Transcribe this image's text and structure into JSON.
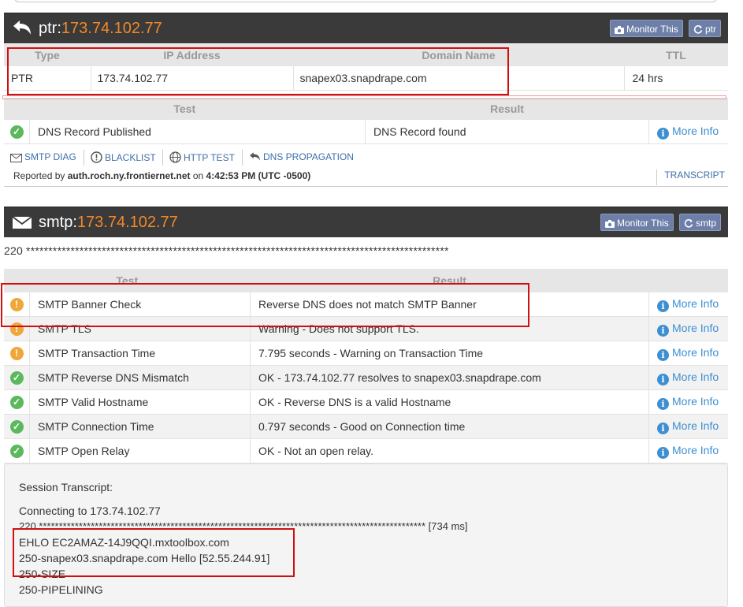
{
  "ptr": {
    "label": "ptr:",
    "ip": "173.74.102.77",
    "monitor_label": "Monitor This",
    "refresh_label": "ptr",
    "headers": [
      "Type",
      "IP Address",
      "Domain Name",
      "TTL"
    ],
    "row": {
      "type": "PTR",
      "ip": "173.74.102.77",
      "domain": "snapex03.snapdrape.com",
      "ttl": "24 hrs"
    },
    "test_headers": [
      "Test",
      "Result"
    ],
    "tests": [
      {
        "status": "ok",
        "test": "DNS Record Published",
        "result": "DNS Record found",
        "more": "More Info"
      }
    ]
  },
  "links": {
    "smtp_diag": "SMTP DIAG",
    "blacklist": "BLACKLIST",
    "http_test": "HTTP TEST",
    "dns_propagation": "DNS PROPAGATION",
    "transcript": "TRANSCRIPT",
    "reported_prefix": "Reported by ",
    "reported_host": "auth.roch.ny.frontiernet.net",
    "reported_mid": " on ",
    "reported_time": "4:42:53 PM (UTC -0500)"
  },
  "smtp": {
    "label": "smtp:",
    "ip": "173.74.102.77",
    "monitor_label": "Monitor This",
    "refresh_label": "smtp",
    "banner": "220 ***********************************************************************************************",
    "headers": [
      "Test",
      "Result"
    ],
    "tests": [
      {
        "status": "warn",
        "test": "SMTP Banner Check",
        "result": "Reverse DNS does not match SMTP Banner",
        "more": "More Info"
      },
      {
        "status": "warn",
        "test": "SMTP TLS",
        "result": "Warning - Does not support TLS.",
        "more": "More Info"
      },
      {
        "status": "warn",
        "test": "SMTP Transaction Time",
        "result": "7.795 seconds - Warning on Transaction Time",
        "more": "More Info"
      },
      {
        "status": "ok",
        "test": "SMTP Reverse DNS Mismatch",
        "result": "OK - 173.74.102.77 resolves to snapex03.snapdrape.com",
        "more": "More Info"
      },
      {
        "status": "ok",
        "test": "SMTP Valid Hostname",
        "result": "OK - Reverse DNS is a valid Hostname",
        "more": "More Info"
      },
      {
        "status": "ok",
        "test": "SMTP Connection Time",
        "result": "0.797 seconds - Good on Connection time",
        "more": "More Info"
      },
      {
        "status": "ok",
        "test": "SMTP Open Relay",
        "result": "OK - Not an open relay.",
        "more": "More Info"
      }
    ]
  },
  "session": {
    "title": "Session Transcript:",
    "lines": [
      "Connecting to 173.74.102.77",
      "220 ************************************************************************************************* [734 ms]",
      "EHLO EC2AMAZ-14J9QQI.mxtoolbox.com",
      "250-snapex03.snapdrape.com Hello [52.55.244.91]",
      "250-SIZE",
      "250-PIPELINING"
    ]
  },
  "colors": {
    "accent_ip": "#f0882a",
    "ok": "#5cb85c",
    "warn": "#f0a73a",
    "info": "#3d8fd1",
    "highlight": "#d01010"
  }
}
